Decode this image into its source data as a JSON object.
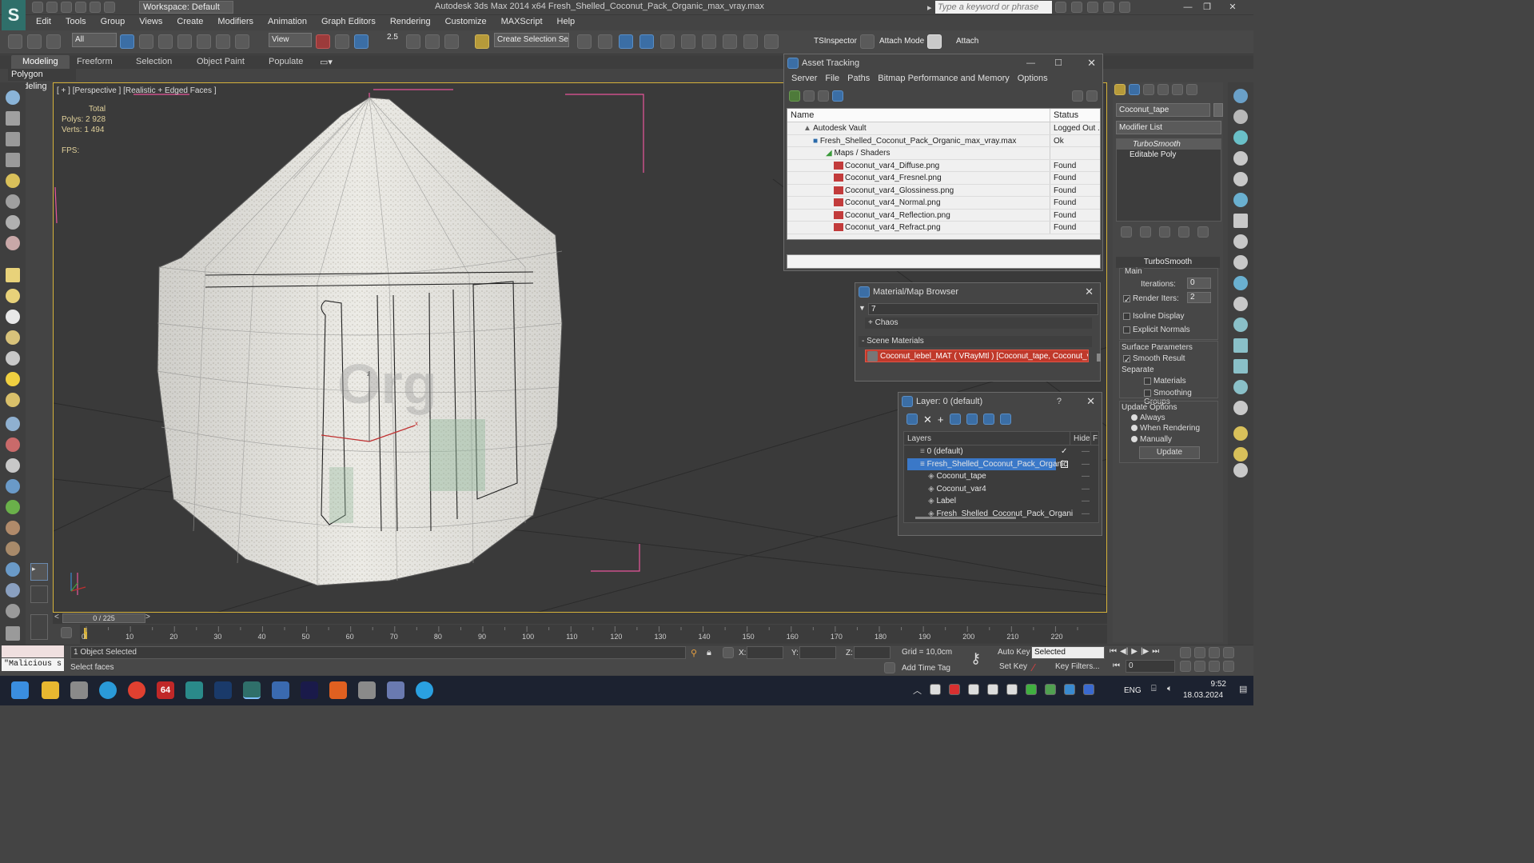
{
  "app": {
    "title": "Autodesk 3ds Max  2014 x64     Fresh_Shelled_Coconut_Pack_Organic_max_vray.max",
    "workspace": "Workspace: Default",
    "search_placeholder": "Type a keyword or phrase"
  },
  "menu": [
    "Edit",
    "Tools",
    "Group",
    "Views",
    "Create",
    "Modifiers",
    "Animation",
    "Graph Editors",
    "Rendering",
    "Customize",
    "MAXScript",
    "Help"
  ],
  "toolbar": {
    "selection_filter": "All",
    "ref_coord": "View",
    "snap_value": "2.5",
    "named_selection": "Create Selection Se",
    "tsinspector": "TSInspector",
    "attach_mode": "Attach Mode",
    "attach": "Attach"
  },
  "ribbon": {
    "tabs": [
      "Modeling",
      "Freeform",
      "Selection",
      "Object Paint",
      "Populate"
    ],
    "active": "Modeling",
    "panel": "Polygon Modeling"
  },
  "viewport": {
    "label": "[ + ] [Perspective ] [Realistic + Edged Faces ]",
    "stats_header": "Total",
    "polys_label": "Polys:",
    "polys": "2 928",
    "verts_label": "Verts:",
    "verts": "1 494",
    "fps_label": "FPS:"
  },
  "asset_tracking": {
    "title": "Asset Tracking",
    "menu": [
      "Server",
      "File",
      "Paths",
      "Bitmap Performance and Memory",
      "Options"
    ],
    "col_name": "Name",
    "col_status": "Status",
    "rows": [
      {
        "name": "Autodesk Vault",
        "status": "Logged Out ."
      },
      {
        "name": "Fresh_Shelled_Coconut_Pack_Organic_max_vray.max",
        "status": "Ok"
      },
      {
        "name": "Maps / Shaders",
        "status": ""
      },
      {
        "name": "Coconut_var4_Diffuse.png",
        "status": "Found"
      },
      {
        "name": "Coconut_var4_Fresnel.png",
        "status": "Found"
      },
      {
        "name": "Coconut_var4_Glossiness.png",
        "status": "Found"
      },
      {
        "name": "Coconut_var4_Normal.png",
        "status": "Found"
      },
      {
        "name": "Coconut_var4_Reflection.png",
        "status": "Found"
      },
      {
        "name": "Coconut_var4_Refract.png",
        "status": "Found"
      }
    ]
  },
  "material_browser": {
    "title": "Material/Map Browser",
    "search": "7",
    "group_chaos": "+ Chaos",
    "group_scene": "- Scene Materials",
    "material": "Coconut_lebel_MAT ( VRayMtl ) [Coconut_tape, Coconut_va..."
  },
  "layer_window": {
    "title": "Layer: 0 (default)",
    "help": "?",
    "col_layers": "Layers",
    "col_hide": "Hide",
    "col_f": "F",
    "rows": [
      {
        "name": "0 (default)",
        "indent": 0,
        "selected": false
      },
      {
        "name": "Fresh_Shelled_Coconut_Pack_Organic",
        "indent": 0,
        "selected": true
      },
      {
        "name": "Coconut_tape",
        "indent": 1,
        "selected": false
      },
      {
        "name": "Coconut_var4",
        "indent": 1,
        "selected": false
      },
      {
        "name": "Label",
        "indent": 1,
        "selected": false
      },
      {
        "name": "Fresh_Shelled_Coconut_Pack_Organi",
        "indent": 1,
        "selected": false
      }
    ]
  },
  "command_panel": {
    "object_name": "Coconut_tape",
    "modifier_list": "Modifier List",
    "stack": [
      "TurboSmooth",
      "Editable Poly"
    ],
    "rollout_title": "TurboSmooth",
    "main": "Main",
    "iterations_label": "Iterations:",
    "iterations": "0",
    "render_iters_label": "Render Iters:",
    "render_iters": "2",
    "isoline": "Isoline Display",
    "explicit_normals": "Explicit Normals",
    "surface_params": "Surface Parameters",
    "smooth_result": "Smooth Result",
    "separate": "Separate",
    "materials": "Materials",
    "smoothing_groups": "Smoothing Groups",
    "update_options": "Update Options",
    "always": "Always",
    "when_rendering": "When Rendering",
    "manually": "Manually",
    "update_button": "Update"
  },
  "timeline": {
    "frame": "0 / 225",
    "ticks": [
      "0",
      "10",
      "20",
      "30",
      "40",
      "50",
      "60",
      "70",
      "80",
      "90",
      "100",
      "110",
      "120",
      "130",
      "140",
      "150",
      "160",
      "170",
      "180",
      "190",
      "200",
      "210",
      "220"
    ]
  },
  "status": {
    "script": "\"Malicious s",
    "objects_selected": "1 Object Selected",
    "prompt": "Select faces",
    "x_label": "X:",
    "y_label": "Y:",
    "z_label": "Z:",
    "grid": "Grid = 10,0cm",
    "add_time_tag": "Add Time Tag",
    "auto_key": "Auto Key",
    "selected": "Selected",
    "set_key": "Set Key",
    "key_filters": "Key Filters...",
    "frame_value": "0"
  },
  "taskbar": {
    "lang": "ENG",
    "time": "9:52",
    "date": "18.03.2024",
    "badge": "64"
  }
}
